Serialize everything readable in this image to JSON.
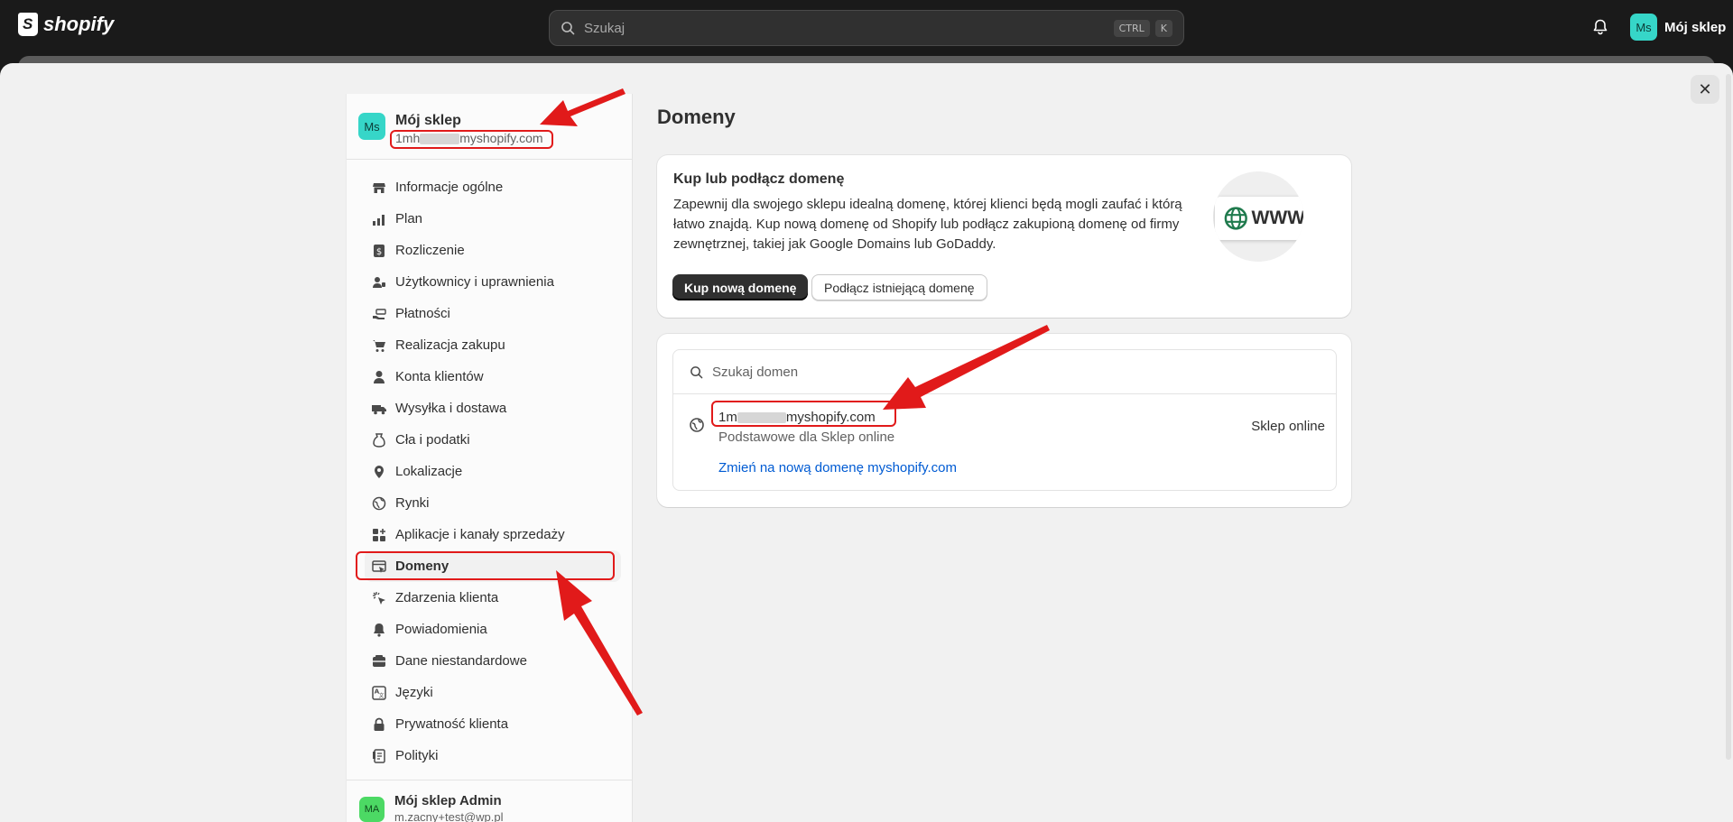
{
  "topbar": {
    "logo_text": "shopify",
    "search_placeholder": "Szukaj",
    "shortcut_key1": "CTRL",
    "shortcut_key2": "K",
    "user_initials": "Ms",
    "user_name": "Mój sklep"
  },
  "sidebar": {
    "store_initials": "Ms",
    "store_name": "Mój sklep",
    "store_url_prefix": "1mh",
    "store_url_suffix": "myshopify.com",
    "items": [
      {
        "label": "Informacje ogólne",
        "icon": "store-icon"
      },
      {
        "label": "Plan",
        "icon": "plan-chart-icon"
      },
      {
        "label": "Rozliczenie",
        "icon": "billing-icon"
      },
      {
        "label": "Użytkownicy i uprawnienia",
        "icon": "users-icon"
      },
      {
        "label": "Płatności",
        "icon": "payments-icon"
      },
      {
        "label": "Realizacja zakupu",
        "icon": "cart-icon"
      },
      {
        "label": "Konta klientów",
        "icon": "person-icon"
      },
      {
        "label": "Wysyłka i dostawa",
        "icon": "truck-icon"
      },
      {
        "label": "Cła i podatki",
        "icon": "tax-icon"
      },
      {
        "label": "Lokalizacje",
        "icon": "location-icon"
      },
      {
        "label": "Rynki",
        "icon": "globe-icon"
      },
      {
        "label": "Aplikacje i kanały sprzedaży",
        "icon": "apps-icon"
      },
      {
        "label": "Domeny",
        "icon": "domains-icon"
      },
      {
        "label": "Zdarzenia klienta",
        "icon": "cursor-click-icon"
      },
      {
        "label": "Powiadomienia",
        "icon": "bell-icon"
      },
      {
        "label": "Dane niestandardowe",
        "icon": "data-icon"
      },
      {
        "label": "Języki",
        "icon": "language-icon"
      },
      {
        "label": "Prywatność klienta",
        "icon": "lock-icon"
      },
      {
        "label": "Polityki",
        "icon": "policy-icon"
      }
    ],
    "active_index": 12,
    "admin_initials": "MA",
    "admin_name": "Mój sklep Admin",
    "admin_email": "m.zacny+test@wp.pl"
  },
  "main": {
    "page_title": "Domeny",
    "promo": {
      "title": "Kup lub podłącz domenę",
      "body": "Zapewnij dla swojego sklepu idealną domenę, której klienci będą mogli zaufać i którą łatwo znajdą. Kup nową domenę od Shopify lub podłącz zakupioną domenę od firmy zewnętrznej, takiej jak Google Domains lub GoDaddy.",
      "buy_button": "Kup nową domenę",
      "connect_button": "Podłącz istniejącą domenę",
      "illustration_text": "WWW"
    },
    "domains": {
      "search_placeholder": "Szukaj domen",
      "rows": [
        {
          "name_prefix": "1m",
          "name_suffix": "myshopify.com",
          "subtitle": "Podstawowe dla Sklep online",
          "channel": "Sklep online",
          "change_link": "Zmień na nową domenę myshopify.com"
        }
      ]
    }
  },
  "colors": {
    "topbar": "#1a1a1a",
    "accent_link": "#005bd3",
    "annotation_red": "#e11a1a",
    "avatar_teal": "#36d6c8",
    "avatar_green": "#4cd964"
  }
}
